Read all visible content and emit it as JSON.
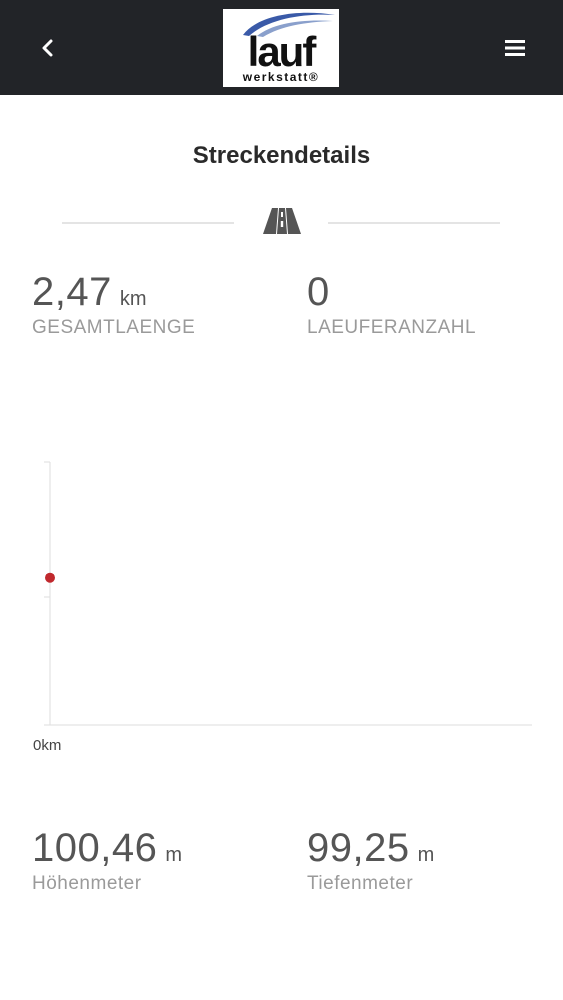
{
  "header": {
    "logo_main": "lauf",
    "logo_sub": "werkstatt®",
    "back_icon": "chevron-left-icon",
    "menu_icon": "hamburger-menu-icon"
  },
  "page_title": "Streckendetails",
  "divider_icon": "road-icon",
  "stats_top": {
    "length": {
      "value": "2,47",
      "unit": "km",
      "label": "GESAMTLAENGE"
    },
    "runners": {
      "value": "0",
      "label": "LAEUFERANZAHL"
    }
  },
  "chart_data": {
    "type": "line",
    "x": [
      0
    ],
    "series": [
      {
        "values": [
          100.46
        ]
      }
    ],
    "x_tick_labels": [
      "0km"
    ],
    "colors": {
      "point": "#c0282d",
      "axis": "#dddddd"
    }
  },
  "stats_bottom": {
    "ascent": {
      "value": "100,46",
      "unit": "m",
      "label": "Höhenmeter"
    },
    "descent": {
      "value": "99,25",
      "unit": "m",
      "label": "Tiefenmeter"
    }
  },
  "colors": {
    "header_bg": "#222428",
    "logo_swoosh": "#3a5aa8",
    "text_dark": "#2a2a2a",
    "text_value": "#555555",
    "text_label": "#9a9a9a"
  }
}
